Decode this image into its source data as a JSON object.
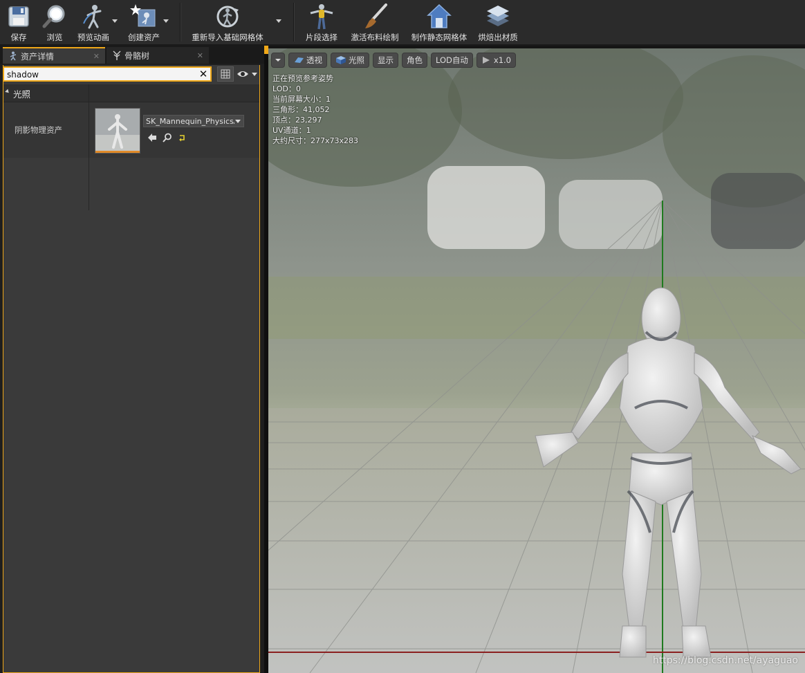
{
  "toolbar": {
    "save": "保存",
    "browse": "浏览",
    "preview_anim": "预览动画",
    "create_asset": "创建资产",
    "reimport_mesh": "重新导入基础网格体",
    "section_select": "片段选择",
    "cloth_paint": "激活布料绘制",
    "make_static_mesh": "制作静态网格体",
    "bake_material": "烘焙出材质"
  },
  "tabs": [
    {
      "label": "资产详情"
    },
    {
      "label": "骨骼树"
    }
  ],
  "details": {
    "search_value": "shadow",
    "category": "光照",
    "property_name": "阴影物理资产",
    "asset_value": "SK_Mannequin_PhysicsAsset"
  },
  "viewport": {
    "buttons": {
      "perspective": "透视",
      "lit": "光照",
      "show": "显示",
      "character": "角色",
      "lod": "LOD自动",
      "speed": "x1.0"
    },
    "info": [
      "正在预览参考姿势",
      "LOD：0",
      "当前屏幕大小：1",
      "三角形：41,052",
      "顶点：23,297",
      "UV通道：1",
      "大约尺寸：277x73x283"
    ],
    "watermark": "https://blog.csdn.net/ayaguao"
  }
}
